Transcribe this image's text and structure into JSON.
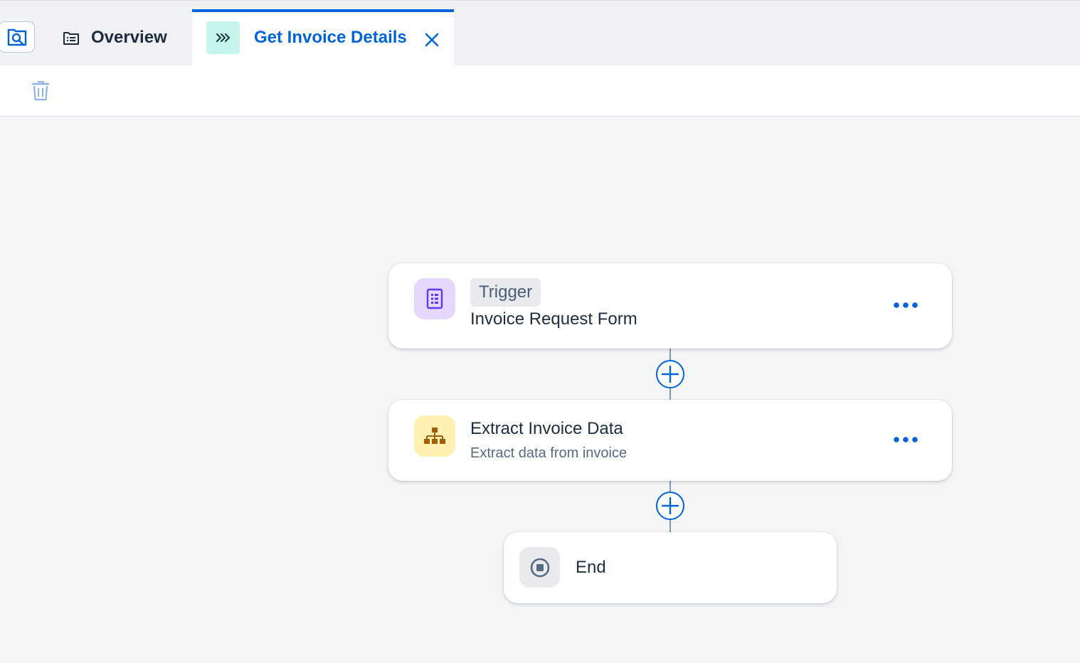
{
  "tabs": {
    "overview_label": "Overview",
    "active_label": "Get Invoice Details"
  },
  "flow": {
    "trigger": {
      "badge": "Trigger",
      "title": "Invoice Request Form",
      "icon": "form-icon"
    },
    "step": {
      "title": "Extract Invoice Data",
      "subtitle": "Extract data from invoice",
      "icon": "hierarchy-icon"
    },
    "end": {
      "title": "End",
      "icon": "stop-icon"
    }
  },
  "colors": {
    "accent": "#0064d9",
    "trigger_icon_bg": "#e5d8fc",
    "step_icon_bg": "#fff0b3",
    "end_icon_bg": "#e8eaed",
    "active_tab_icon_bg": "#c5f5ec"
  }
}
